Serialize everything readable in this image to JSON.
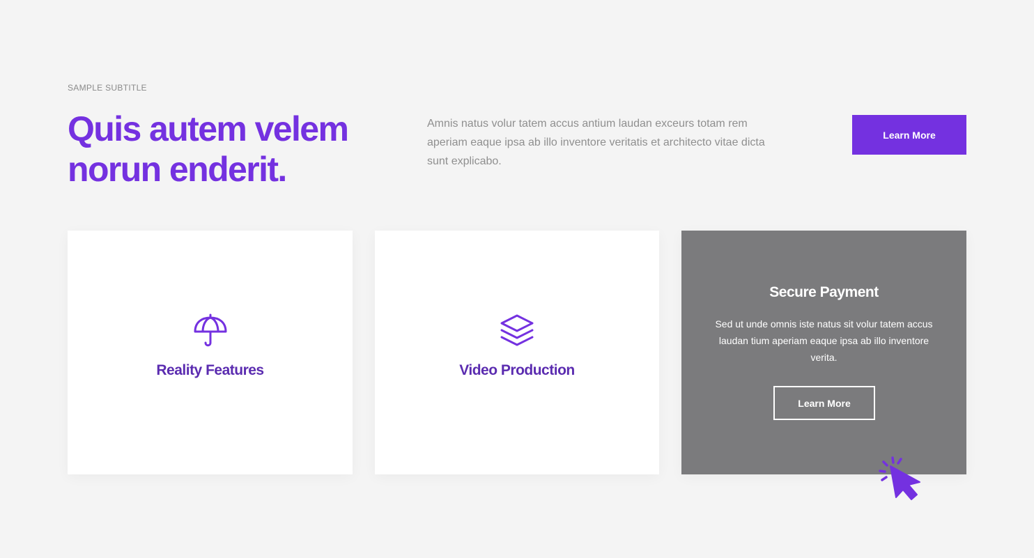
{
  "header": {
    "subtitle": "SAMPLE SUBTITLE",
    "title": "Quis autem velem norun enderit.",
    "description": "Amnis natus volur tatem accus antium laudan exceurs totam rem aperiam eaque ipsa ab illo inventore veritatis et architecto vitae dicta sunt explicabo.",
    "cta_label": "Learn More"
  },
  "cards": [
    {
      "title": "Reality Features",
      "icon": "umbrella-icon"
    },
    {
      "title": "Video Production",
      "icon": "layers-icon"
    },
    {
      "title": "Secure Payment",
      "text": "Sed ut unde omnis iste natus sit volur tatem accus laudan tium aperiam eaque ipsa ab illo inventore verita.",
      "button_label": "Learn More"
    }
  ],
  "colors": {
    "accent": "#7431e0",
    "card_hover": "#7b7b7d",
    "background": "#f4f4f4"
  },
  "decor": {
    "pointer_icon": "click-pointer-icon"
  }
}
